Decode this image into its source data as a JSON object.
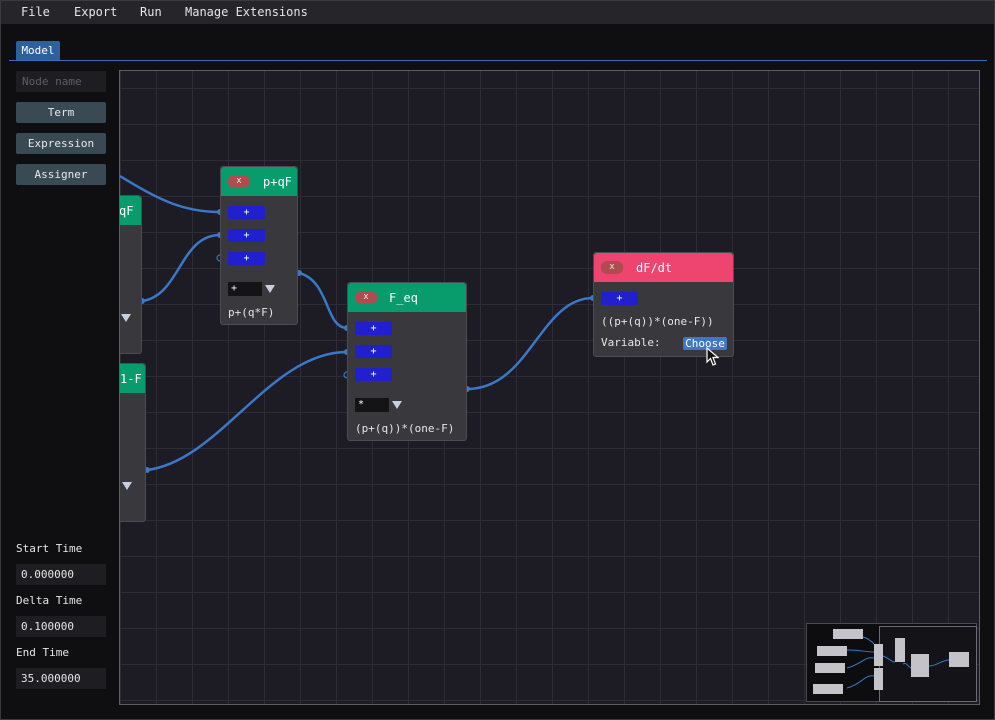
{
  "menubar": {
    "items": [
      "File",
      "Export",
      "Run",
      "Manage Extensions"
    ]
  },
  "tabs": [
    {
      "label": "Model",
      "active": true
    }
  ],
  "sidebar": {
    "node_name_placeholder": "Node name",
    "buttons": [
      "Term",
      "Expression",
      "Assigner"
    ],
    "start_time_label": "Start Time",
    "start_time_value": "0.000000",
    "delta_time_label": "Delta Time",
    "delta_time_value": "0.100000",
    "end_time_label": "End Time",
    "end_time_value": "35.000000"
  },
  "nodes": {
    "partial_qf": {
      "title_fragment": "qF"
    },
    "partial_one_minus_f": {
      "title_fragment": "1-F"
    },
    "p_plus_qf": {
      "title": "p+qF",
      "close": "x",
      "pins": [
        "+",
        "+",
        "+"
      ],
      "operator": "+",
      "expression": "p+(q*F)"
    },
    "f_eq": {
      "title": "F_eq",
      "close": "x",
      "pins": [
        "+",
        "+",
        "+"
      ],
      "operator": "*",
      "expression": "(p+(q))*(one-F)"
    },
    "df_dt": {
      "title": "dF/dt",
      "close": "x",
      "pins": [
        "+"
      ],
      "expression": "((p+(q))*(one-F))",
      "variable_label": "Variable:",
      "choose_label": "Choose"
    }
  },
  "colors": {
    "term_header": "#089c6c",
    "assigner_header": "#ee4470",
    "pin": "#2020cf",
    "wire": "#3a78c8",
    "accent": "#2e5f9e"
  },
  "icons": {
    "dropdown": "triangle-down",
    "cursor": "arrow-pointer"
  }
}
